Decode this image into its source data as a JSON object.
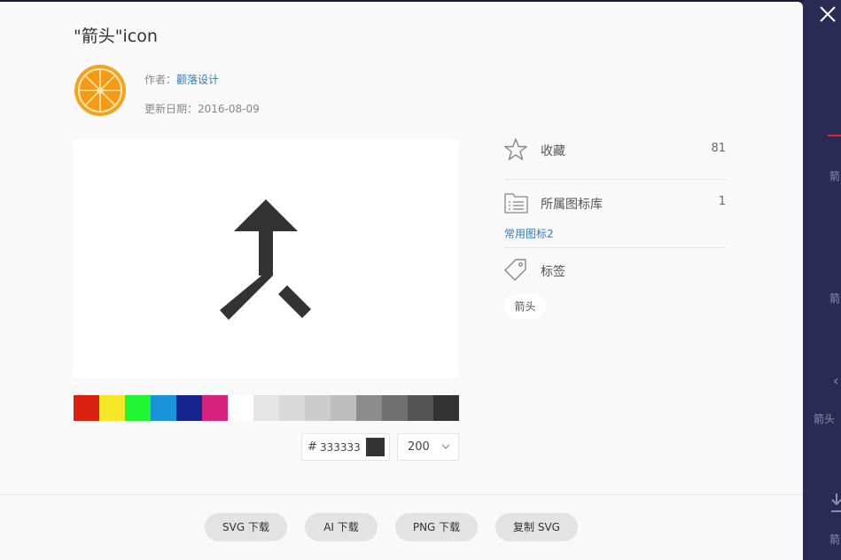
{
  "icon": {
    "title": "\"箭头\"icon",
    "author_prefix": "作者：",
    "author_name": "颧落设计",
    "date_prefix": "更新日期：",
    "date_value": "2016-08-09"
  },
  "palette": [
    "#dc2010",
    "#f5e626",
    "#1ff532",
    "#1b93dc",
    "#15248f",
    "#d8237e",
    "#ffffff",
    "#e5e5e5",
    "#d9d9d9",
    "#cccccc",
    "#bebebe",
    "#8c8c8c",
    "#707070",
    "#545454",
    "#333333"
  ],
  "color_picker": {
    "hash": "#",
    "value": "333333",
    "current_color": "#333333"
  },
  "size_select": {
    "value": "200"
  },
  "stats": {
    "favorites": {
      "label": "收藏",
      "count": "81"
    },
    "library": {
      "label": "所属图标库",
      "count": "1",
      "link": "常用图标2"
    },
    "tags": {
      "label": "标签",
      "items": [
        "箭头"
      ]
    }
  },
  "downloads": {
    "svg": "SVG 下载",
    "ai": "AI 下载",
    "png": "PNG 下载",
    "copy_svg": "复制 SVG"
  },
  "background": {
    "items": [
      "箭",
      "箭",
      "箭头",
      "箭"
    ]
  },
  "colors": {
    "accent_link": "#2d7ec0",
    "backdrop": "#2b2a52",
    "modal_bg": "#f9f9f9",
    "icon_color": "#333333"
  },
  "icons": {
    "close": "close-icon",
    "favorite": "star-icon",
    "library": "folder-list-icon",
    "tag": "tag-icon",
    "chevron": "chevron-down-icon",
    "glyph": "merge-arrow-icon"
  }
}
